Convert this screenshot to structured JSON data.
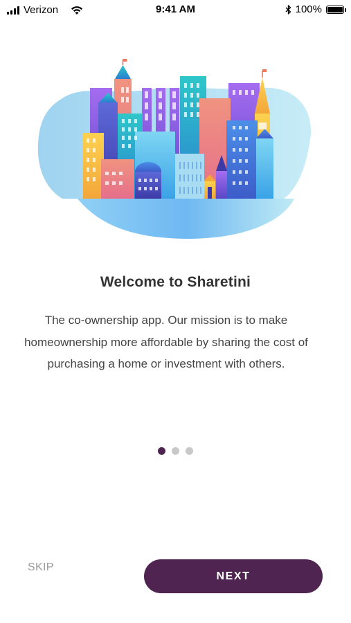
{
  "status_bar": {
    "carrier": "Verizon",
    "time": "9:41 AM",
    "battery_percent": "100%",
    "battery_level": 1.0,
    "icons": [
      "signal-icon",
      "wifi-icon",
      "bluetooth-icon",
      "battery-icon"
    ]
  },
  "onboarding": {
    "illustration": "city-buildings-illustration",
    "title": "Welcome to Sharetini",
    "description": "The co-ownership app. Our mission is to make homeownership more affordable by sharing the cost of purchasing a home or investment with others.",
    "page_indicator": {
      "total": 3,
      "active": 1
    }
  },
  "actions": {
    "skip_label": "SKIP",
    "next_label": "NEXT"
  },
  "colors": {
    "accent": "#4f2451",
    "dot_inactive": "#c8c8c8",
    "skip_text": "#9a9a9a",
    "title_text": "#333333"
  }
}
